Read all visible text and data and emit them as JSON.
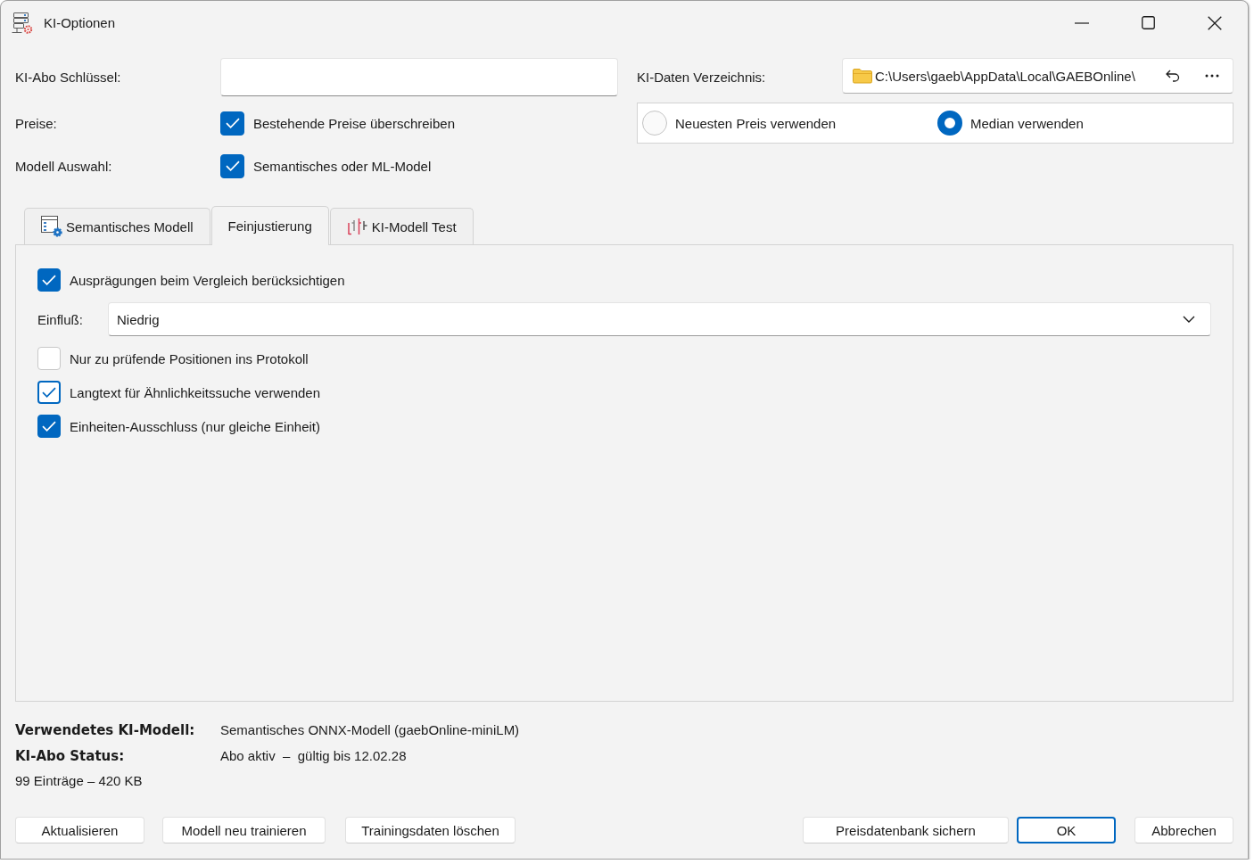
{
  "window": {
    "title": "KI-Optionen"
  },
  "subscription_key": {
    "label": "KI-Abo Schlüssel:"
  },
  "data_directory": {
    "label": "KI-Daten Verzeichnis:",
    "value": "C:\\Users\\gaeb\\AppData\\Local\\GAEBOnline\\"
  },
  "prices": {
    "label": "Preise:",
    "option": {
      "label": "Bestehende Preise überschreiben",
      "checked": true
    }
  },
  "price_mode": [
    {
      "label": "Neuesten Preis verwenden",
      "selected": false
    },
    {
      "label": "Median verwenden",
      "selected": true
    }
  ],
  "model_selection": {
    "label": "Modell Auswahl:",
    "option": {
      "label": "Semantisches oder ML-Model",
      "checked": true
    }
  },
  "tabs": [
    {
      "label": "Semantisches Modell",
      "selected": false
    },
    {
      "label": "Feinjustierung",
      "selected": true
    },
    {
      "label": "KI-Modell Test",
      "selected": false
    }
  ],
  "fine_tuning": [
    {
      "kind": "checkbox",
      "label": "Ausprägungen beim Vergleich berücksichtigen",
      "checked": true,
      "focused": false
    },
    {
      "kind": "dropdown",
      "label": "Einfluß:",
      "value": "Niedrig"
    },
    {
      "kind": "checkbox",
      "label": "Nur zu prüfende Positionen ins Protokoll",
      "checked": false,
      "focused": false
    },
    {
      "kind": "checkbox",
      "label": "Langtext für Ähnlichkeitssuche verwenden",
      "checked": true,
      "focused": true
    },
    {
      "kind": "checkbox",
      "label": "Einheiten-Ausschluss (nur gleiche Einheit)",
      "checked": true,
      "focused": false
    }
  ],
  "status": {
    "rows": [
      {
        "label": "Verwendetes KI-Modell:",
        "value": "Semantisches ONNX-Modell (gaebOnline-miniLM)"
      },
      {
        "label": "KI-Abo Status:",
        "value": "Abo aktiv  –  gültig bis 12.02.28"
      }
    ],
    "storage": "99 Einträge – 420 KB"
  },
  "buttons_left": [
    "Aktualisieren",
    "Modell neu trainieren",
    "Trainingsdaten löschen"
  ],
  "buttons_right": [
    {
      "label": "Preisdatenbank sichern",
      "default": false
    },
    {
      "label": "OK",
      "default": true
    },
    {
      "label": "Abbrechen",
      "default": false
    }
  ]
}
